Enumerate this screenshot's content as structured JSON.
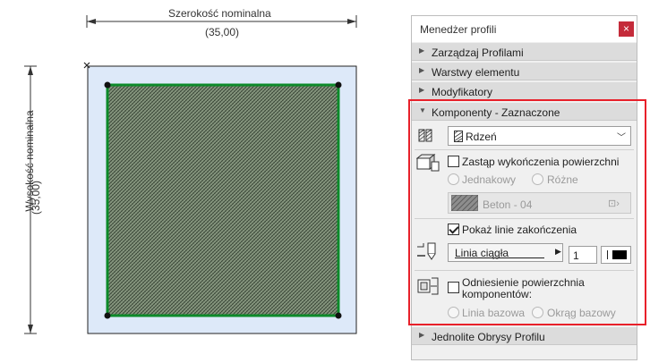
{
  "drawing": {
    "width_label": "Szerokość nominalna",
    "width_value": "(35,00)",
    "height_label": "Wysokość nominalna",
    "height_value": "(35,00)"
  },
  "panel": {
    "title": "Menedżer profili",
    "close_glyph": "×",
    "sections": [
      {
        "label": "Zarządzaj Profilami",
        "expanded": false
      },
      {
        "label": "Warstwy elementu",
        "expanded": false
      },
      {
        "label": "Modyfikatory",
        "expanded": false
      },
      {
        "label": "Komponenty - Zaznaczone",
        "expanded": true
      },
      {
        "label": "Jednolite Obrysy Profilu",
        "expanded": false
      }
    ],
    "components": {
      "material": "Rdzeń",
      "override_surface_label": "Zastąp wykończenia powierzchni",
      "override_surface_checked": false,
      "radio_uniform": "Jednakowy",
      "radio_different": "Różne",
      "surface_value": "Beton - 04",
      "show_end_lines_label": "Pokaż linie zakończenia",
      "show_end_lines_checked": true,
      "line_type": "Linia ciągła",
      "pen_number": "1",
      "surface_reference_label_1": "Odniesienie powierzchnia",
      "surface_reference_label_2": "komponentów:",
      "surface_reference_checked": false,
      "radio_baseline": "Linia bazowa",
      "radio_base_circle": "Okrąg bazowy"
    }
  },
  "colors": {
    "fill_green": "#0d8a2a",
    "light_blue": "#dde9f9",
    "highlight_red": "#e8202a",
    "close_red": "#c42b3a"
  }
}
